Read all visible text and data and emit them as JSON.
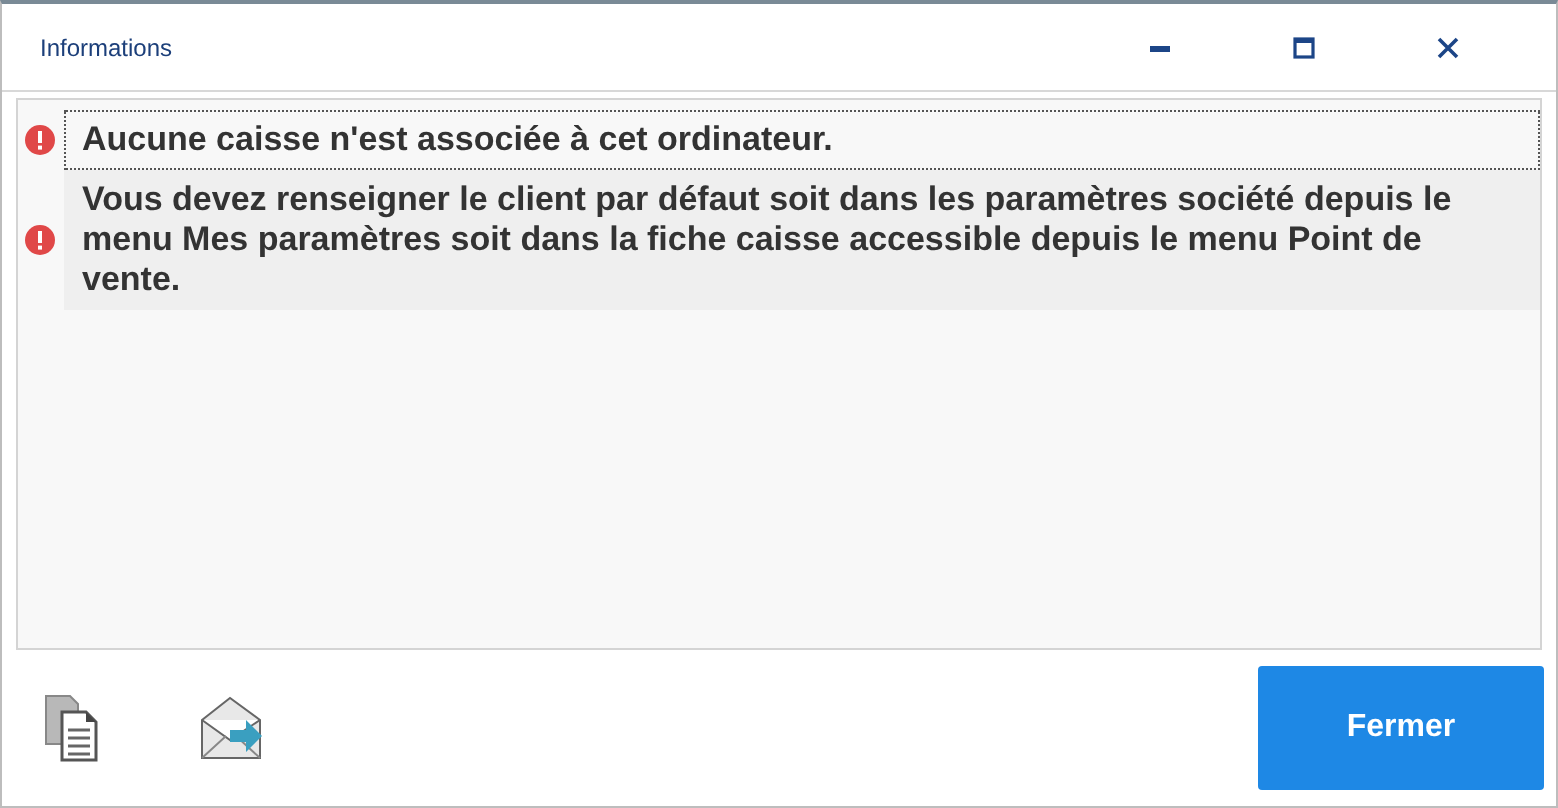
{
  "window": {
    "title": "Informations"
  },
  "messages": [
    {
      "kind": "error",
      "text": "Aucune caisse n'est associée à cet ordinateur.",
      "selected": true
    },
    {
      "kind": "error",
      "text": "Vous devez renseigner le client par défaut soit dans les paramètres société depuis le menu Mes paramètres soit dans la fiche caisse accessible depuis le menu Point de vente.",
      "selected": false
    }
  ],
  "buttons": [
    {
      "label": "Fermer"
    }
  ]
}
